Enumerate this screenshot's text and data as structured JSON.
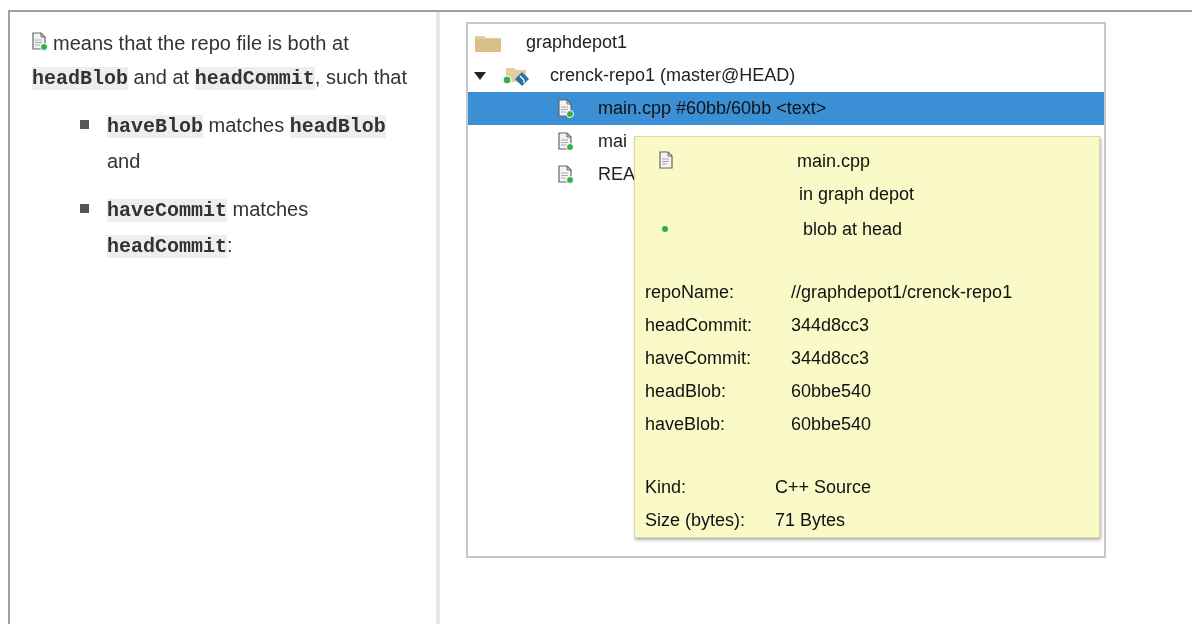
{
  "description": {
    "text": "means that the repo file is both at **headBlob** and at **headCommit**, such that",
    "bullets": [
      "**haveBlob** matches **headBlob** and",
      "**haveCommit** matches **headCommit**:"
    ]
  },
  "tree": {
    "items": [
      {
        "kind": "folder",
        "label": "graphdepot1",
        "selected": false,
        "children": [
          {
            "kind": "repo",
            "label": "crenck-repo1 (master@HEAD)",
            "expanded": true,
            "selected": false,
            "children": [
              {
                "kind": "file",
                "label": "main.cpp #60bb/60bb <text>",
                "selected": true
              },
              {
                "kind": "file",
                "label": "mai",
                "selected": false
              },
              {
                "kind": "file",
                "label": "REA",
                "selected": false
              }
            ]
          }
        ]
      }
    ]
  },
  "tooltip": {
    "title": "main.cpp",
    "subtitle": "in graph depot",
    "status": "blob at head",
    "properties": [
      {
        "label": "repoName:",
        "value": "//graphdepot1/crenck-repo1"
      },
      {
        "label": "headCommit:",
        "value": "344d8cc3"
      },
      {
        "label": "haveCommit:",
        "value": "344d8cc3"
      },
      {
        "label": "headBlob:",
        "value": "60bbe540"
      },
      {
        "label": "haveBlob:",
        "value": "60bbe540"
      }
    ],
    "details": [
      {
        "label": "Kind:",
        "value": "C++ Source"
      },
      {
        "label": "Size (bytes):",
        "value": "71 Bytes"
      }
    ]
  }
}
